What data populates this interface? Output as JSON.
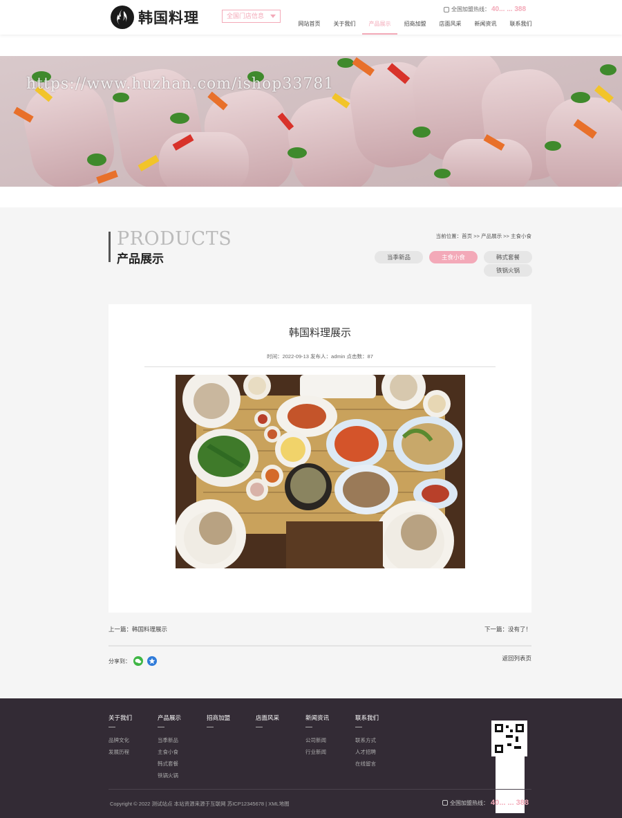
{
  "header": {
    "logo_text": "韩国料理",
    "store_select": "全国门店信息",
    "hotline_label": "全国加盟热线：",
    "hotline_number": "40... ... 388",
    "nav": [
      "网站首页",
      "关于我们",
      "产品展示",
      "招商加盟",
      "店面风采",
      "新闻资讯",
      "联系我们"
    ],
    "active_nav_index": 2
  },
  "banner": {
    "watermark": "https://www.huzhan.com/ishop33781"
  },
  "section": {
    "title_en": "PRODUCTS",
    "title_cn": "产品展示",
    "breadcrumb": "当前位置：首页 >> 产品展示 >> 主食小食",
    "categories": [
      "当季新品",
      "主食小食",
      "韩式套餐",
      "铁锅火锅"
    ],
    "active_category_index": 1
  },
  "article": {
    "title": "韩国料理展示",
    "meta": "时间：2022-09-13    发布人：admin    点击数：87",
    "prev": "上一篇：韩国料理展示",
    "next": "下一篇：没有了！",
    "share_label": "分享到：",
    "back_to_list": "返回列表页"
  },
  "footer": {
    "columns": [
      {
        "title": "关于我们",
        "links": [
          "品牌文化",
          "发展历程"
        ]
      },
      {
        "title": "产品展示",
        "links": [
          "当季新品",
          "主食小食",
          "韩式套餐",
          "铁锅火锅"
        ]
      },
      {
        "title": "招商加盟",
        "links": []
      },
      {
        "title": "店面风采",
        "links": []
      },
      {
        "title": "新闻资讯",
        "links": [
          "公司新闻",
          "行业新闻"
        ]
      },
      {
        "title": "联系我们",
        "links": [
          "联系方式",
          "人才招聘",
          "在线留言"
        ]
      }
    ],
    "copyright": "Copyright © 2022 测试站点 本站资源来源于互联网 苏ICP12345678  |  XML地图",
    "hotline_label": "全国加盟热线：",
    "hotline_number": "40... ... 388"
  },
  "colors": {
    "accent": "#f3a9b8",
    "footer_bg": "#332b35",
    "main_bg": "#f5f5f5"
  }
}
